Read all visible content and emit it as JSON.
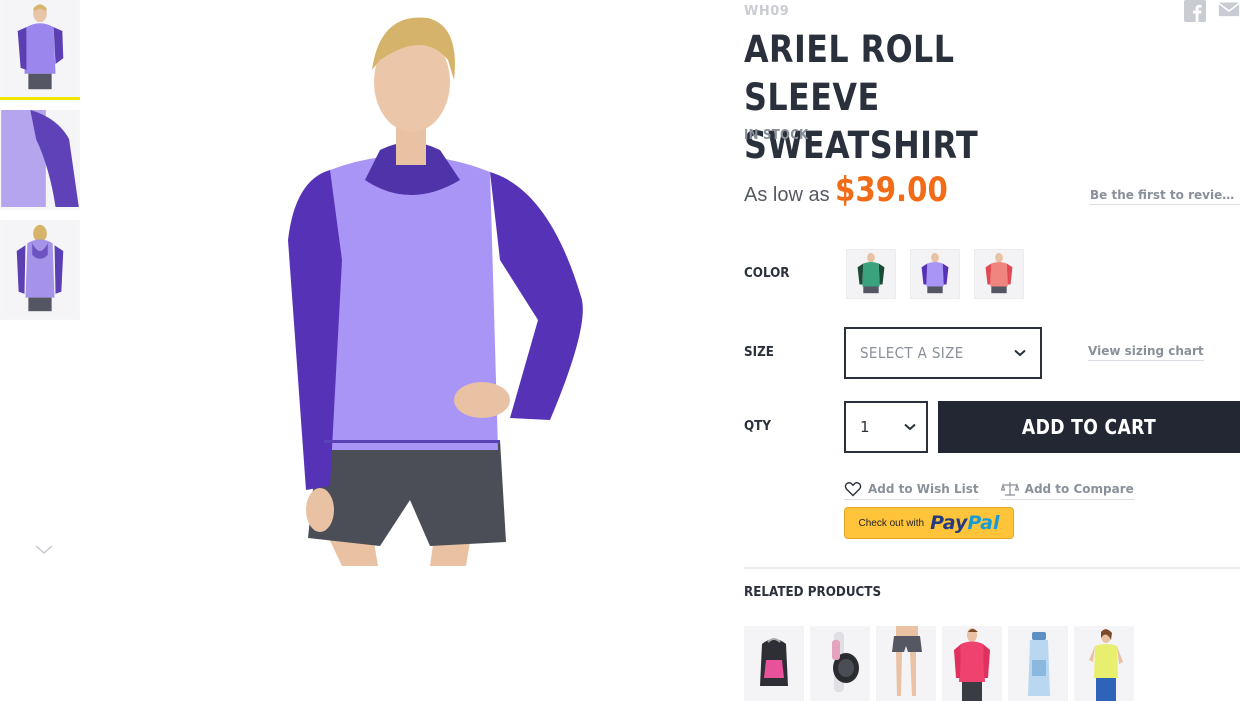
{
  "product": {
    "sku": "WH09",
    "title": "ARIEL ROLL SLEEVE SWEATSHIRT",
    "stock": "IN STOCK",
    "price_prefix": "As low as",
    "price": "$39.00",
    "review_link": "Be the first to review t..."
  },
  "options": {
    "color_label": "COLOR",
    "colors": [
      "green",
      "purple",
      "red"
    ],
    "size_label": "SIZE",
    "size_placeholder": "SELECT A SIZE",
    "sizing_chart_link": "View sizing chart",
    "qty_label": "QTY",
    "qty_value": "1"
  },
  "actions": {
    "add_to_cart": "ADD TO CART",
    "wishlist": "Add to Wish List",
    "compare": "Add to Compare",
    "paypal_prefix": "Check out with",
    "paypal_pay": "Pay",
    "paypal_pal": "Pal"
  },
  "related": {
    "title": "RELATED PRODUCTS",
    "items": [
      "backpack",
      "watch",
      "shorts",
      "pink-hoodie",
      "water-bottle",
      "yellow-tee"
    ]
  },
  "colors": {
    "accent_price": "#f26b16",
    "button_dark": "#222733",
    "active_thumb_border": "#f2e500",
    "paypal_yellow": "#ffc439"
  },
  "icons": [
    "facebook-icon",
    "mail-icon",
    "heart-icon",
    "scale-icon",
    "chevron-down-icon"
  ]
}
